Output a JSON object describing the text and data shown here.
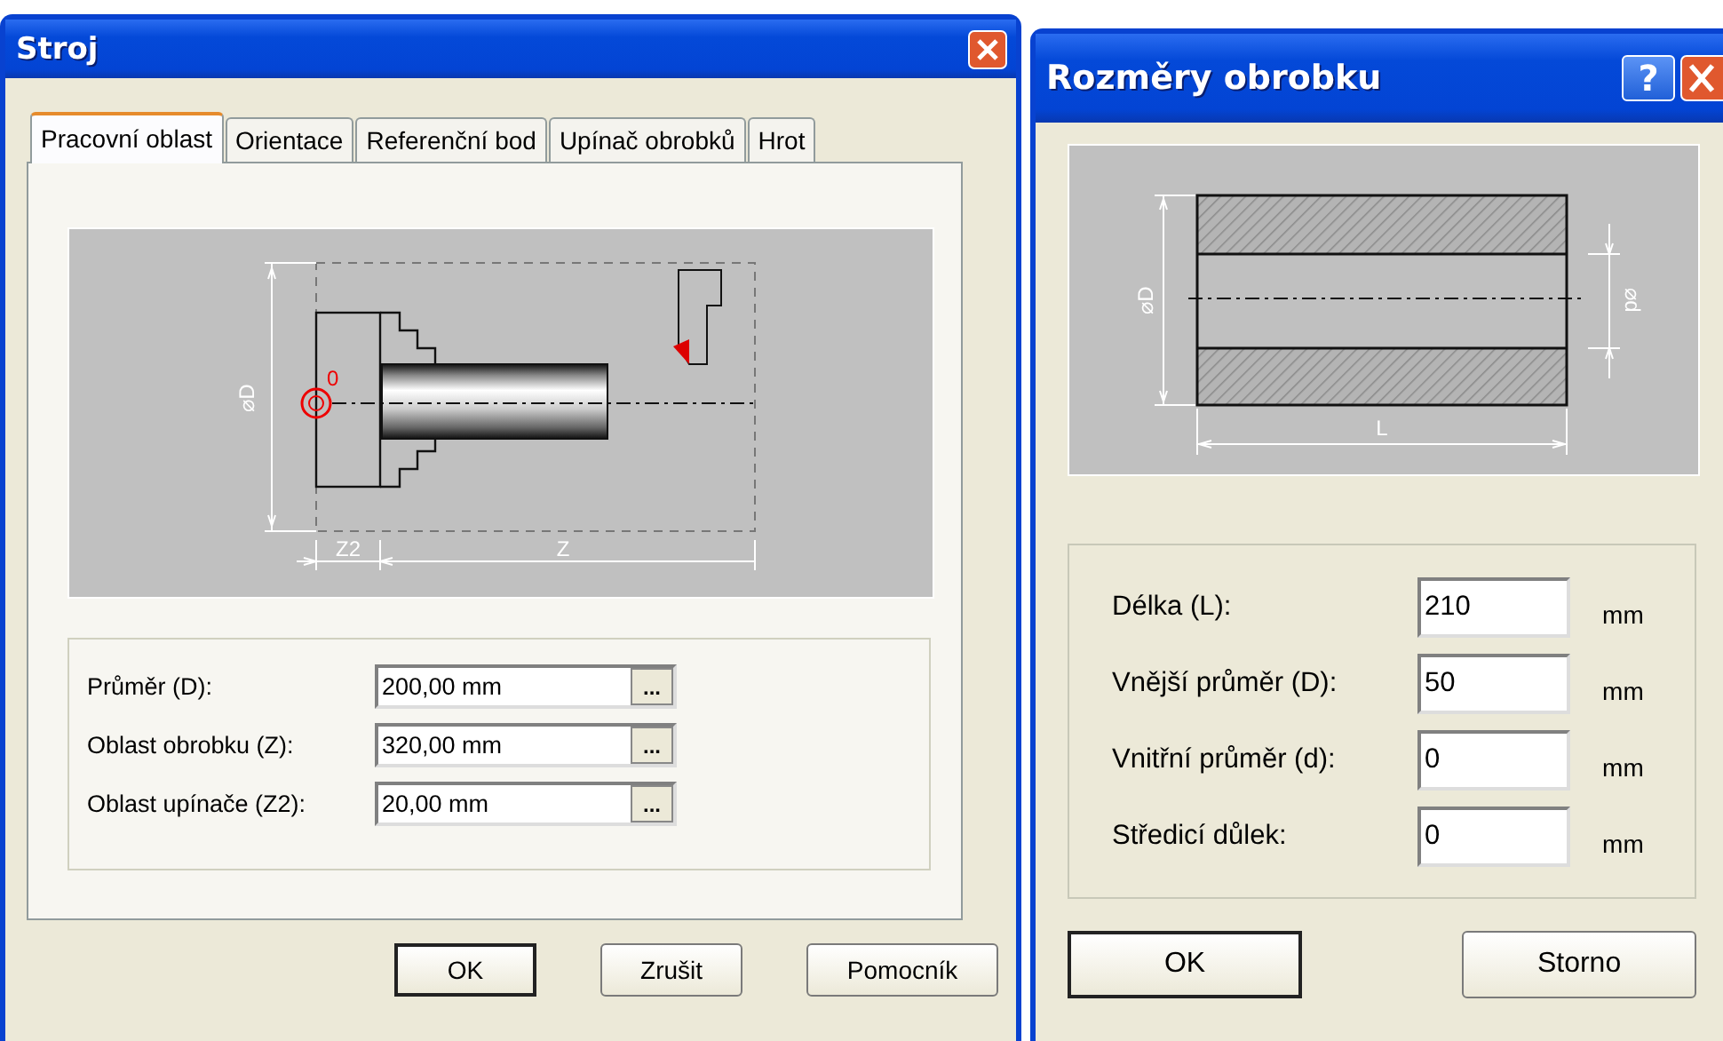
{
  "machine_dialog": {
    "title": "Stroj",
    "tabs": [
      {
        "label": "Pracovní oblast",
        "selected": true
      },
      {
        "label": "Orientace",
        "selected": false
      },
      {
        "label": "Referenční bod",
        "selected": false
      },
      {
        "label": "Upínač obrobků",
        "selected": false
      },
      {
        "label": "Hrot",
        "selected": false
      }
    ],
    "diagram_labels": {
      "diameter": "⌀D",
      "origin": "0",
      "chuck_length": "Z2",
      "work_length": "Z"
    },
    "fields": [
      {
        "label": "Průměr (D):",
        "value": "200,00 mm",
        "browse": "..."
      },
      {
        "label": "Oblast obrobku (Z):",
        "value": "320,00 mm",
        "browse": "..."
      },
      {
        "label": "Oblast upínače (Z2):",
        "value": "20,00 mm",
        "browse": "..."
      }
    ],
    "buttons": [
      {
        "label": "OK",
        "default": true
      },
      {
        "label": "Zrušit",
        "default": false
      },
      {
        "label": "Pomocník",
        "default": false
      }
    ]
  },
  "workpiece_dialog": {
    "title": "Rozměry obrobku",
    "help": "?",
    "diagram_labels": {
      "outer": "⌀D",
      "inner": "⌀d",
      "length": "L"
    },
    "fields": [
      {
        "label": "Délka (L):",
        "value": "210",
        "unit": "mm"
      },
      {
        "label": "Vnější průměr (D):",
        "value": "50",
        "unit": "mm"
      },
      {
        "label": "Vnitřní průměr (d):",
        "value": "0",
        "unit": "mm"
      },
      {
        "label": "Středicí důlek:",
        "value": "0",
        "unit": "mm"
      }
    ],
    "buttons": [
      {
        "label": "OK",
        "default": true
      },
      {
        "label": "Storno",
        "default": false
      }
    ]
  }
}
